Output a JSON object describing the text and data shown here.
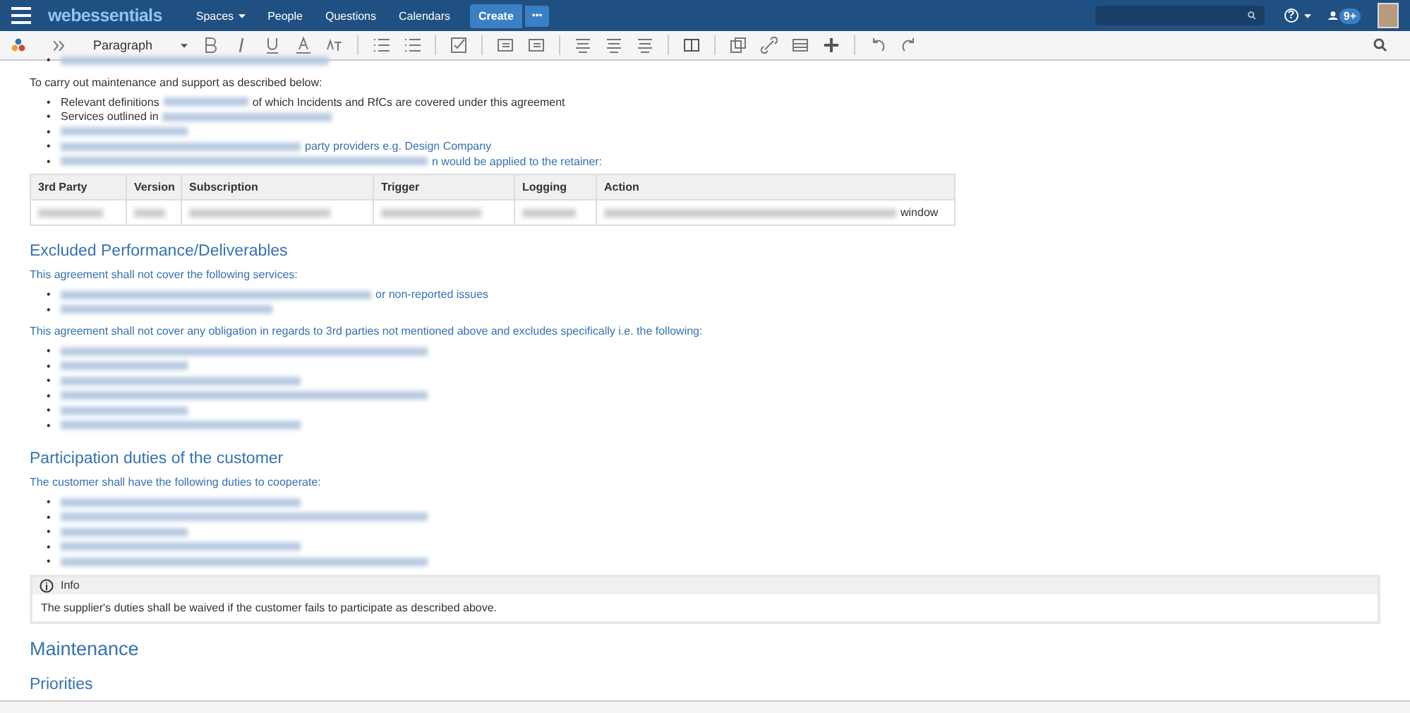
{
  "topbar": {
    "logo": "webessentials",
    "nav": [
      {
        "label": "Spaces",
        "dropdown": true
      },
      {
        "label": "People",
        "dropdown": false
      },
      {
        "label": "Questions",
        "dropdown": false
      },
      {
        "label": "Calendars",
        "dropdown": false
      }
    ],
    "create": "Create",
    "more": "•••",
    "help": "?",
    "notifications": "9+"
  },
  "marker": "•",
  "toolbar": {
    "style": "Paragraph"
  },
  "content": [
    {
      "kind": "bullets",
      "items": [
        [
          {
            "kind": "redacted"
          }
        ]
      ]
    },
    {
      "kind": "para",
      "parts": [
        {
          "kind": "text",
          "text": "To carry out maintenance and support as described below:"
        }
      ]
    },
    {
      "kind": "bullets",
      "items": [
        [
          {
            "kind": "text",
            "text": "Relevant definitions"
          },
          {
            "kind": "redacted"
          },
          {
            "kind": "text",
            "text": "of which Incidents and RfCs are covered under this agreement"
          }
        ],
        [
          {
            "kind": "text",
            "text": "Services outlined in"
          },
          {
            "kind": "redacted"
          }
        ],
        [
          {
            "kind": "redacted"
          }
        ],
        [
          {
            "kind": "redacted"
          },
          {
            "kind": "link",
            "text": "party providers e.g. Design Company"
          }
        ],
        [
          {
            "kind": "redacted"
          },
          {
            "kind": "link",
            "text": "n would be applied to the retainer:"
          }
        ]
      ]
    },
    {
      "kind": "table",
      "columns": [
        "3rd Party",
        "Version",
        "Subscription",
        "Trigger",
        "Logging",
        "Action"
      ],
      "rows": [
        [
          [
            {
              "kind": "redacted"
            }
          ],
          [
            {
              "kind": "redacted"
            }
          ],
          [
            {
              "kind": "redacted"
            }
          ],
          [
            {
              "kind": "redacted"
            }
          ],
          [
            {
              "kind": "redacted"
            }
          ],
          [
            {
              "kind": "redacted"
            },
            {
              "kind": "text",
              "text": "window"
            }
          ]
        ]
      ]
    },
    {
      "kind": "h2",
      "parts": [
        {
          "kind": "link",
          "text": "Excluded Performance/Deliverables"
        }
      ]
    },
    {
      "kind": "para",
      "parts": [
        {
          "kind": "link",
          "text": "This agreement shall not cover the following services:"
        }
      ]
    },
    {
      "kind": "bullets",
      "items": [
        [
          {
            "kind": "redacted"
          },
          {
            "kind": "link",
            "text": "or non-reported issues"
          }
        ],
        [
          {
            "kind": "redacted"
          }
        ]
      ]
    },
    {
      "kind": "para",
      "parts": [
        {
          "kind": "link",
          "text": "This agreement shall not cover any obligation in regards to 3rd parties not mentioned above and excludes specifically i.e. the following:"
        }
      ]
    },
    {
      "kind": "bullets",
      "items": [
        [
          {
            "kind": "redacted"
          }
        ],
        [
          {
            "kind": "redacted"
          }
        ],
        [
          {
            "kind": "redacted"
          }
        ],
        [
          {
            "kind": "redacted"
          }
        ],
        [
          {
            "kind": "redacted"
          }
        ],
        [
          {
            "kind": "redacted"
          }
        ]
      ]
    },
    {
      "kind": "h2",
      "parts": [
        {
          "kind": "link",
          "text": "Participation duties of the customer"
        }
      ]
    },
    {
      "kind": "para",
      "parts": [
        {
          "kind": "link",
          "text": "The customer shall have the following duties to cooperate:"
        }
      ]
    },
    {
      "kind": "bullets",
      "items": [
        [
          {
            "kind": "redacted"
          }
        ],
        [
          {
            "kind": "redacted"
          }
        ],
        [
          {
            "kind": "redacted"
          }
        ],
        [
          {
            "kind": "redacted"
          }
        ],
        [
          {
            "kind": "redacted"
          }
        ]
      ]
    },
    {
      "kind": "info",
      "title": "Info",
      "body": "The supplier's duties shall be waived if the customer fails to participate as described above."
    },
    {
      "kind": "h1",
      "parts": [
        {
          "kind": "link",
          "text": "Maintenance"
        }
      ]
    },
    {
      "kind": "h2",
      "parts": [
        {
          "kind": "link",
          "text": "Priorities"
        }
      ]
    }
  ]
}
